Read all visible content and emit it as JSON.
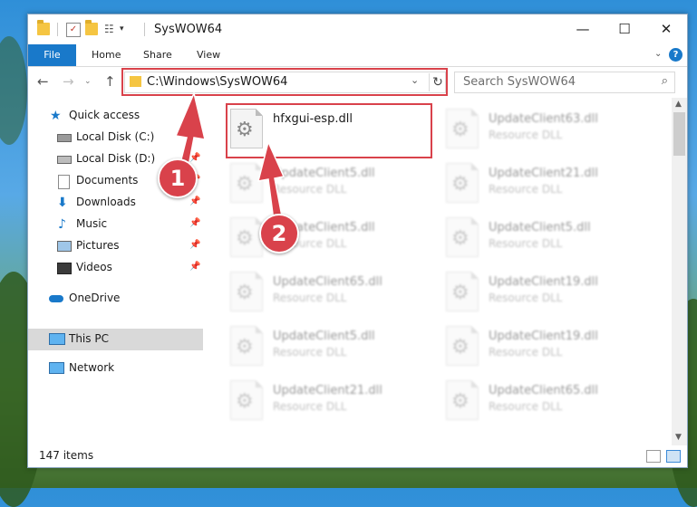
{
  "window": {
    "title": "SysWOW64"
  },
  "ribbon": {
    "tabs": [
      "File",
      "Home",
      "Share",
      "View"
    ],
    "help_icon": "help-icon"
  },
  "window_controls": {
    "minimize": "—",
    "maximize": "☐",
    "close": "✕"
  },
  "navigation": {
    "address": "C:\\Windows\\SysWOW64",
    "search_placeholder": "Search SysWOW64"
  },
  "sidebar": {
    "items": [
      {
        "label": "Quick access",
        "icon": "star-icon",
        "pinned": false
      },
      {
        "label": "Local Disk (C:)",
        "icon": "drive-icon",
        "pinned": true
      },
      {
        "label": "Local Disk (D:)",
        "icon": "drive-icon",
        "pinned": true
      },
      {
        "label": "Documents",
        "icon": "documents-icon",
        "pinned": true
      },
      {
        "label": "Downloads",
        "icon": "download-icon",
        "pinned": true
      },
      {
        "label": "Music",
        "icon": "music-icon",
        "pinned": true
      },
      {
        "label": "Pictures",
        "icon": "pictures-icon",
        "pinned": true
      },
      {
        "label": "Videos",
        "icon": "videos-icon",
        "pinned": true
      },
      {
        "label": "OneDrive",
        "icon": "cloud-icon",
        "pinned": false
      },
      {
        "label": "This PC",
        "icon": "computer-icon",
        "pinned": false,
        "selected": true
      },
      {
        "label": "Network",
        "icon": "network-icon",
        "pinned": false
      }
    ]
  },
  "files": [
    {
      "name": "hfxgui-esp.dll",
      "type": "",
      "highlighted": true
    },
    {
      "name": "UpdateClient63.dll",
      "type": "Resource DLL"
    },
    {
      "name": "UpdateClient5.dll",
      "type": "Resource DLL"
    },
    {
      "name": "UpdateClient21.dll",
      "type": "Resource DLL"
    },
    {
      "name": "UpdateClient5.dll",
      "type": "Resource DLL"
    },
    {
      "name": "UpdateClient5.dll",
      "type": "Resource DLL"
    },
    {
      "name": "UpdateClient65.dll",
      "type": "Resource DLL"
    },
    {
      "name": "UpdateClient19.dll",
      "type": "Resource DLL"
    },
    {
      "name": "UpdateClient5.dll",
      "type": "Resource DLL"
    },
    {
      "name": "UpdateClient19.dll",
      "type": "Resource DLL"
    },
    {
      "name": "UpdateClient21.dll",
      "type": "Resource DLL"
    },
    {
      "name": "UpdateClient65.dll",
      "type": "Resource DLL"
    }
  ],
  "status": {
    "item_count": "147 items"
  },
  "annotations": {
    "step1": "1",
    "step2": "2",
    "color": "#d9424b"
  }
}
